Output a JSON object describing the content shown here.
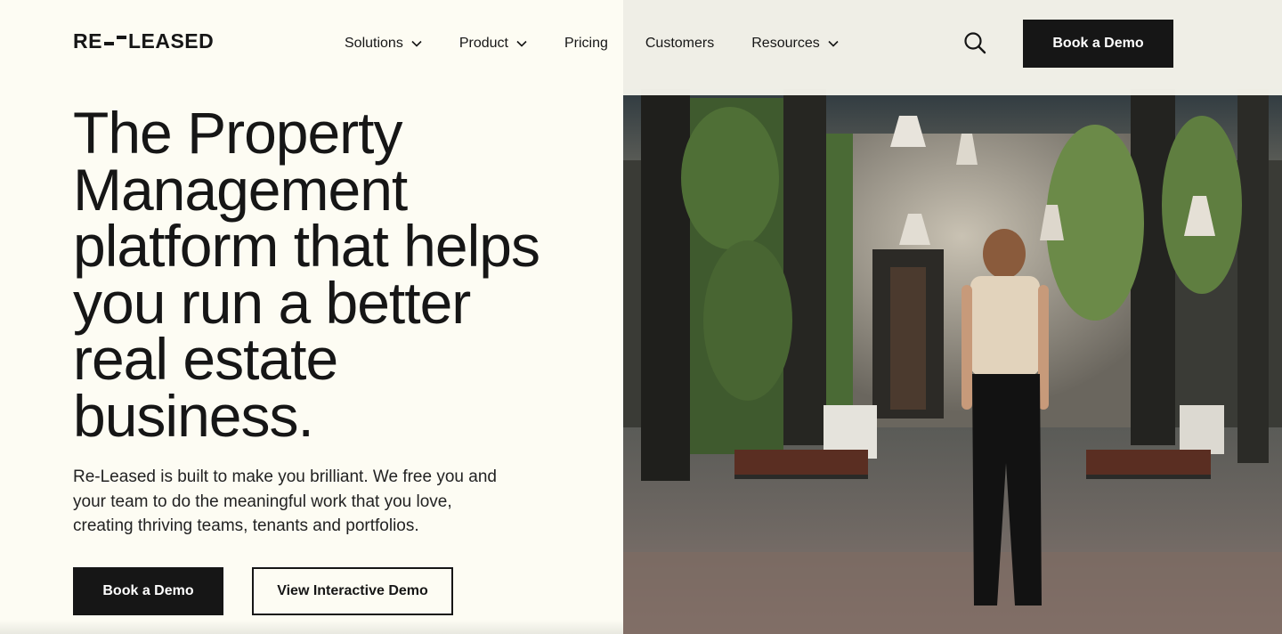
{
  "brand": {
    "logo_text_left": "RE",
    "logo_text_right": "LEASED"
  },
  "nav": {
    "items": [
      {
        "label": "Solutions",
        "has_dropdown": true
      },
      {
        "label": "Product",
        "has_dropdown": true
      },
      {
        "label": "Pricing",
        "has_dropdown": false
      },
      {
        "label": "Customers",
        "has_dropdown": false
      },
      {
        "label": "Resources",
        "has_dropdown": true
      }
    ],
    "search_icon": "search-icon",
    "cta_label": "Book a Demo"
  },
  "hero": {
    "headline_lines": [
      "The Property",
      "Management",
      "platform that helps",
      "you run a better",
      "real estate",
      "business."
    ],
    "subtext_lines": [
      "Re-Leased is built to make you brilliant. We free you and",
      "your team to do the meaningful work that you love,",
      "creating thriving teams, tenants and portfolios."
    ],
    "primary_cta": "Book a Demo",
    "secondary_cta": "View Interactive Demo"
  },
  "colors": {
    "background": "#fdfcf3",
    "text": "#161616",
    "button_dark": "#161616",
    "button_text": "#ffffff"
  }
}
